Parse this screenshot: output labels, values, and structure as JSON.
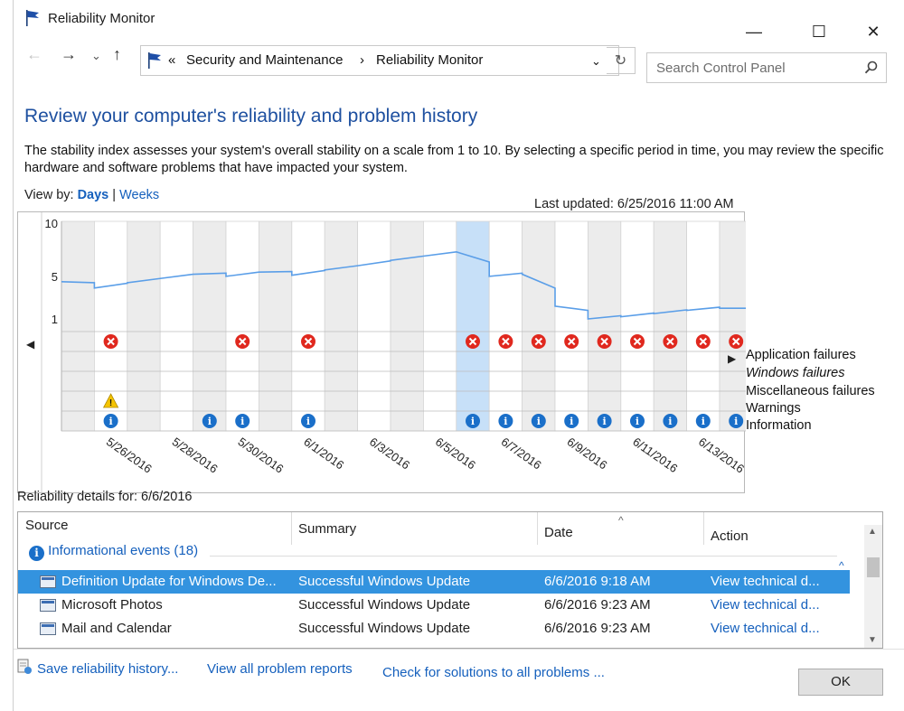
{
  "window": {
    "title": "Reliability Monitor",
    "minimize": "—",
    "maximize": "☐",
    "close": "✕"
  },
  "nav": {
    "back": "←",
    "forward": "→",
    "recent": "⌄",
    "up": "↑",
    "breadcrumb_prefix": "«",
    "breadcrumb": [
      "Security and Maintenance",
      "Reliability Monitor"
    ],
    "separator": "›",
    "dropdown": "⌄",
    "refresh": "↻",
    "search_placeholder": "Search Control Panel"
  },
  "content": {
    "heading": "Review your computer's reliability and problem history",
    "description": "The stability index assesses your system's overall stability on a scale from 1 to 10. By selecting a specific period in time, you may review the specific hardware and software problems that have impacted your system.",
    "view_by_label": "View by:",
    "view_days": "Days",
    "view_sep": "|",
    "view_weeks": "Weeks",
    "last_updated": "Last updated: 6/25/2016 11:00 AM"
  },
  "chart_data": {
    "type": "line",
    "y_ticks": [
      "10",
      "5",
      "1"
    ],
    "ylim": [
      1,
      10
    ],
    "x_tick_labels": [
      "5/26/2016",
      "5/28/2016",
      "5/30/2016",
      "6/1/2016",
      "6/3/2016",
      "6/5/2016",
      "6/7/2016",
      "6/9/2016",
      "6/11/2016",
      "6/13/2016"
    ],
    "dates": [
      "5/25",
      "5/26",
      "5/27",
      "5/28",
      "5/29",
      "5/30",
      "5/31",
      "6/1",
      "6/2",
      "6/3",
      "6/4",
      "6/5",
      "6/6",
      "6/7",
      "6/8",
      "6/9",
      "6/10",
      "6/11",
      "6/12",
      "6/13",
      "6/14"
    ],
    "selected_date": "6/6",
    "stability_index": [
      4.5,
      3.9,
      4.4,
      4.8,
      5.2,
      5.0,
      5.4,
      5.1,
      5.6,
      6.0,
      6.5,
      6.9,
      7.3,
      5.0,
      5.2,
      2.2,
      1.0,
      1.2,
      1.5,
      1.8,
      2.0
    ],
    "rows": [
      "Application failures",
      "Windows failures",
      "Miscellaneous failures",
      "Warnings",
      "Information"
    ],
    "events": {
      "Application failures": [
        "5/26",
        "5/30",
        "6/1",
        "6/6",
        "6/7",
        "6/8",
        "6/9",
        "6/10",
        "6/11",
        "6/12",
        "6/13",
        "6/14"
      ],
      "Windows failures": [],
      "Miscellaneous failures": [],
      "Warnings": [
        "5/26"
      ],
      "Information": [
        "5/26",
        "5/29",
        "5/30",
        "6/1",
        "6/6",
        "6/7",
        "6/8",
        "6/9",
        "6/10",
        "6/11",
        "6/12",
        "6/13",
        "6/14"
      ]
    },
    "scroll_left": "◀",
    "scroll_right": "▶"
  },
  "details": {
    "label": "Reliability details for: 6/6/2016",
    "columns": [
      "Source",
      "Summary",
      "Date",
      "Action"
    ],
    "sort_indicator": "^",
    "group": {
      "icon": "i",
      "label": "Informational events (18)",
      "collapse": "^"
    },
    "rows": [
      {
        "source": "Definition Update for Windows De...",
        "summary": "Successful Windows Update",
        "date": "6/6/2016 9:18 AM",
        "action": "View  technical d..."
      },
      {
        "source": "Microsoft Photos",
        "summary": "Successful Windows Update",
        "date": "6/6/2016 9:23 AM",
        "action": "View  technical d..."
      },
      {
        "source": "Mail and Calendar",
        "summary": "Successful Windows Update",
        "date": "6/6/2016 9:23 AM",
        "action": "View  technical d..."
      }
    ],
    "scroll_up": "▲",
    "scroll_down": "▼"
  },
  "footer": {
    "save_history": "Save reliability history...",
    "view_reports": "View all problem reports",
    "check_solutions": "Check for solutions to all problems ...",
    "ok": "OK"
  },
  "colors": {
    "heading": "#1e50a0",
    "link": "#1560bd",
    "selection": "#3393df",
    "error": "#e0281e",
    "warning": "#f5c400",
    "info": "#1a6fc9",
    "line": "#5a9ee8",
    "column_highlight": "#c7e0f8"
  }
}
